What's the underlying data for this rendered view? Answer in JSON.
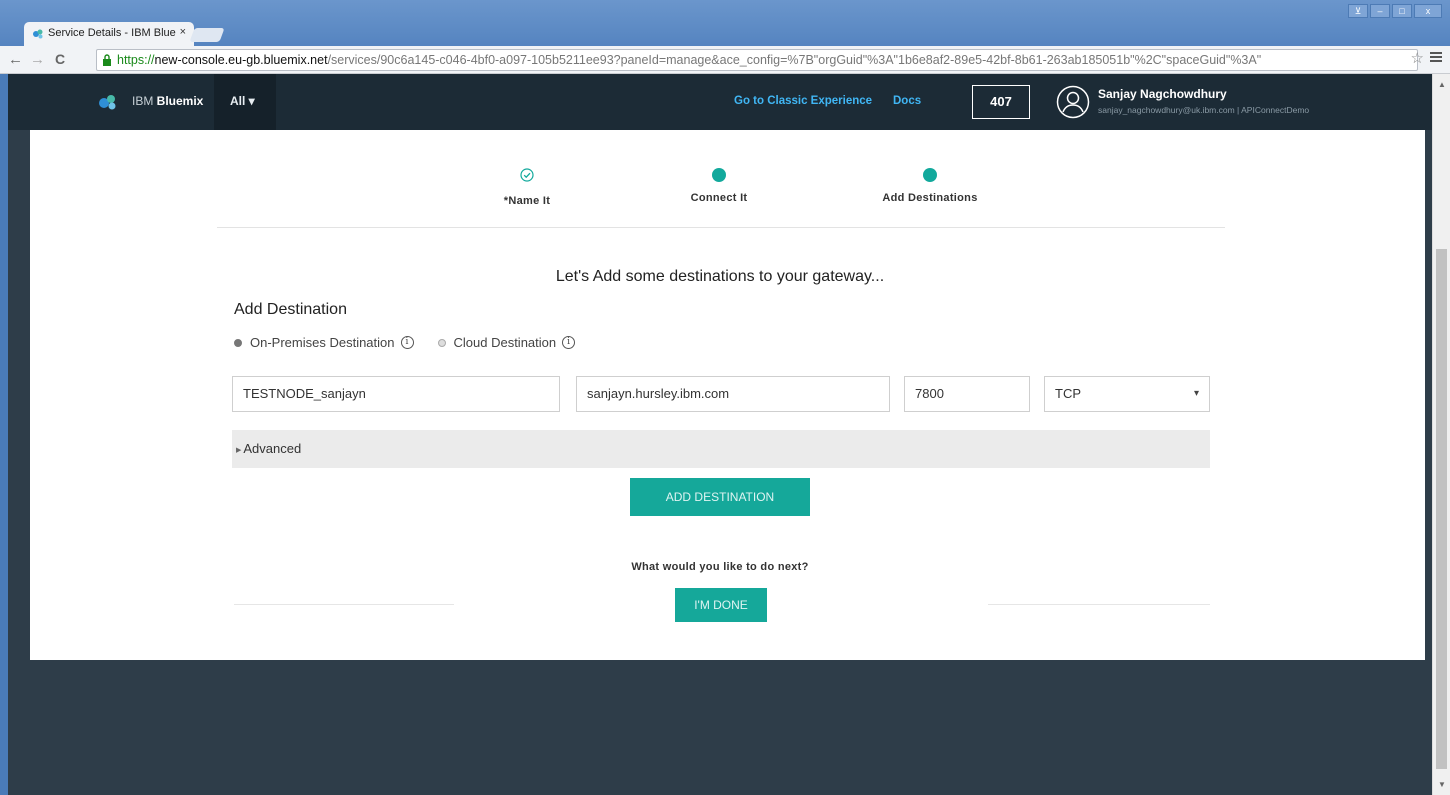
{
  "browser": {
    "tab_title": "Service Details - IBM Blue",
    "tab_close": "×",
    "url_secure": "https://",
    "url_host": "new-console.eu-gb.bluemix.net",
    "url_path": "/services/90c6a145-c046-4bf0-a097-105b5211ee93?paneId=manage&ace_config=%7B\"orgGuid\"%3A\"1b6e8af2-89e5-42bf-8b61-263ab185051b\"%2C\"spaceGuid\"%3A\"",
    "window_buttons": [
      "⊻",
      "–",
      "□",
      "x"
    ]
  },
  "header": {
    "brand_prefix": "IBM ",
    "brand_name": "Bluemix",
    "all_menu": "All ▾",
    "classic_link": "Go to Classic Experience",
    "docs_link": "Docs",
    "counter": "407",
    "user_name": "Sanjay Nagchowdhury",
    "user_email": "sanjay_nagchowdhury@uk.ibm.com | APIConnectDemo"
  },
  "steps": [
    {
      "label": "*Name It",
      "state": "complete"
    },
    {
      "label": "Connect It",
      "state": "active"
    },
    {
      "label": "Add Destinations",
      "state": "active"
    }
  ],
  "main": {
    "heading": "Let's Add some destinations to your gateway...",
    "section_title": "Add Destination",
    "radio_on_prem": "On-Premises Destination",
    "radio_cloud": "Cloud Destination",
    "info_glyph": "i",
    "selected_radio": "On-Premises Destination",
    "name_value": "TESTNODE_sanjayn",
    "host_value": "sanjayn.hursley.ibm.com",
    "port_value": "7800",
    "protocol_value": "TCP",
    "advanced_label": "Advanced",
    "add_button": "ADD DESTINATION",
    "next_question": "What would you like to do next?",
    "done_button": "I'M DONE"
  },
  "colors": {
    "accent": "#15a89a",
    "header_bg": "#1c2b36",
    "link": "#40b6f4"
  }
}
